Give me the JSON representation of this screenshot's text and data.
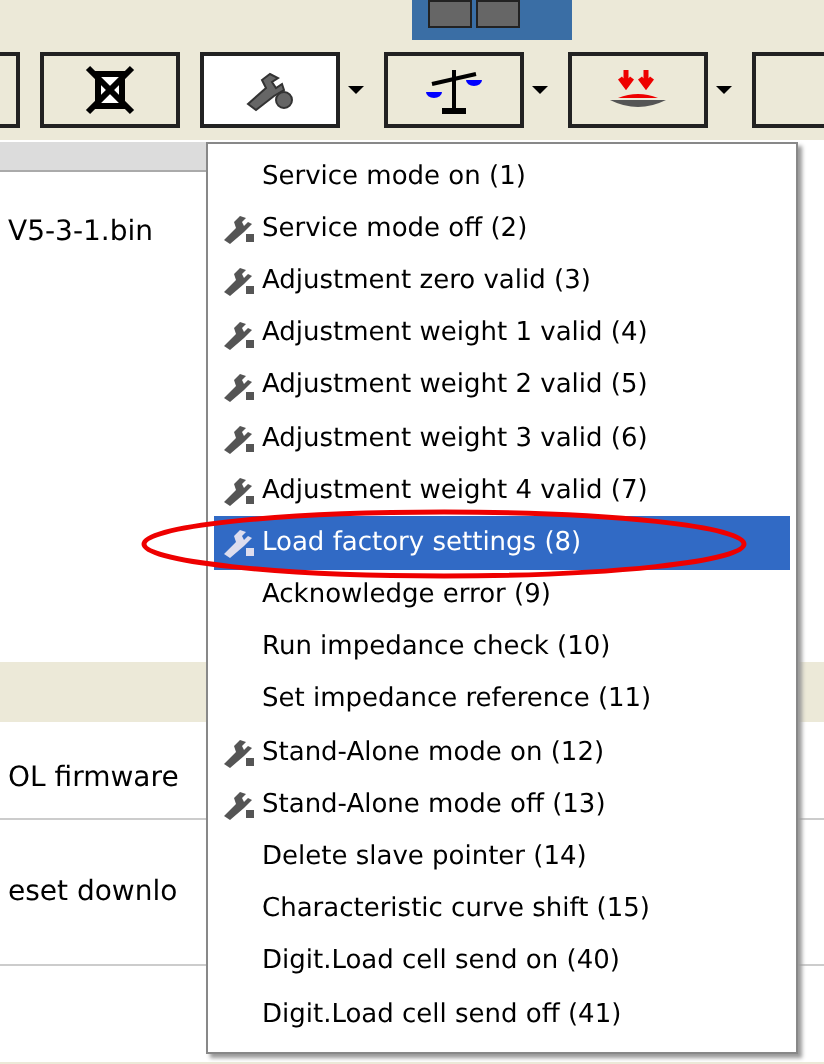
{
  "toolbar": {
    "buttons": [
      {
        "kind": "cut"
      },
      {
        "kind": "delete"
      },
      {
        "kind": "service",
        "pressed": true,
        "dropdown": true
      },
      {
        "kind": "scale",
        "pressed": false,
        "dropdown": true
      },
      {
        "kind": "load",
        "pressed": false,
        "dropdown": true
      },
      {
        "kind": "cut"
      }
    ]
  },
  "background_rows": [
    {
      "text": "V5-3-1.bin"
    },
    {
      "text": "OL firmware"
    },
    {
      "text": "eset downlo"
    }
  ],
  "menu": {
    "items": [
      {
        "label": "Service mode on (1)",
        "icon": false,
        "selected": false
      },
      {
        "label": "Service mode off (2)",
        "icon": true,
        "selected": false
      },
      {
        "label": "Adjustment zero valid (3)",
        "icon": true,
        "selected": false
      },
      {
        "label": "Adjustment weight 1 valid (4)",
        "icon": true,
        "selected": false
      },
      {
        "label": "Adjustment weight 2 valid (5)",
        "icon": true,
        "selected": false
      },
      {
        "label": "Adjustment weight 3 valid (6)",
        "icon": true,
        "selected": false
      },
      {
        "label": "Adjustment weight 4 valid (7)",
        "icon": true,
        "selected": false
      },
      {
        "label": "Load factory settings (8)",
        "icon": true,
        "selected": true
      },
      {
        "label": "Acknowledge error (9)",
        "icon": false,
        "selected": false
      },
      {
        "label": "Run impedance check (10)",
        "icon": false,
        "selected": false
      },
      {
        "label": "Set impedance reference (11)",
        "icon": false,
        "selected": false
      },
      {
        "label": "Stand-Alone mode on (12)",
        "icon": true,
        "selected": false
      },
      {
        "label": "Stand-Alone mode off (13)",
        "icon": true,
        "selected": false
      },
      {
        "label": "Delete slave pointer (14)",
        "icon": false,
        "selected": false
      },
      {
        "label": "Characteristic curve shift (15)",
        "icon": false,
        "selected": false
      },
      {
        "label": "Digit.Load cell send on (40)",
        "icon": false,
        "selected": false
      },
      {
        "label": "Digit.Load cell send off (41)",
        "icon": false,
        "selected": false
      }
    ]
  },
  "annotation": {
    "kind": "ellipse"
  }
}
